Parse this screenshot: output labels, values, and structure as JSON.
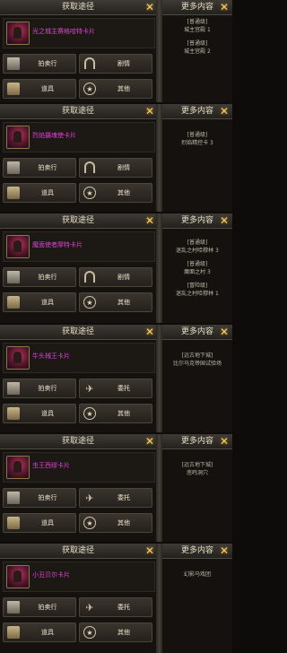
{
  "panels": [
    {
      "left_title": "获取途径",
      "right_title": "更多内容",
      "item_name": "光之城主赛格哈特卡片",
      "buttons": [
        "拍卖行",
        "剧情",
        "道具",
        "其他"
      ],
      "info_lines": [
        "[普通级]",
        "城主宫殿 1",
        "[普通级]",
        "城主宫殿 2"
      ]
    },
    {
      "left_title": "获取途径",
      "right_title": "更多内容",
      "item_name": "烈焰摄魂使卡片",
      "buttons": [
        "拍卖行",
        "剧情",
        "道具",
        "其他"
      ],
      "info_lines": [
        "[普通级]",
        "烈焰精控卡 3"
      ]
    },
    {
      "left_title": "获取途径",
      "right_title": "更多内容",
      "item_name": "魔面使者摩特卡片",
      "buttons": [
        "拍卖行",
        "剧情",
        "道具",
        "其他"
      ],
      "info_lines": [
        "[普通级]",
        "迷乱之村哈穆林 3",
        "[普通级]",
        "魔面之村 3",
        "[冒险级]",
        "迷乱之村哈穆林 1"
      ]
    },
    {
      "left_title": "获取途径",
      "right_title": "更多内容",
      "item_name": "牛头械王卡片",
      "buttons": [
        "拍卖行",
        "委托",
        "道具",
        "其他"
      ],
      "info_lines": [
        "[远古地下城]",
        "比尔马克帝国试验场"
      ]
    },
    {
      "left_title": "获取途径",
      "right_title": "更多内容",
      "item_name": "虫王西缪卡片",
      "buttons": [
        "拍卖行",
        "委托",
        "道具",
        "其他"
      ],
      "info_lines": [
        "[远古地下城]",
        "悲鸣洞穴"
      ]
    },
    {
      "left_title": "获取途径",
      "right_title": "更多内容",
      "item_name": "小丑贝尔卡片",
      "buttons": [
        "拍卖行",
        "委托",
        "道具",
        "其他"
      ],
      "info_lines": [
        "幻影马戏团"
      ]
    }
  ],
  "close_glyph": "✕",
  "colors": {
    "item_name": "#e040d8",
    "close": "#f1cd6a",
    "header": "#3e3b36"
  }
}
